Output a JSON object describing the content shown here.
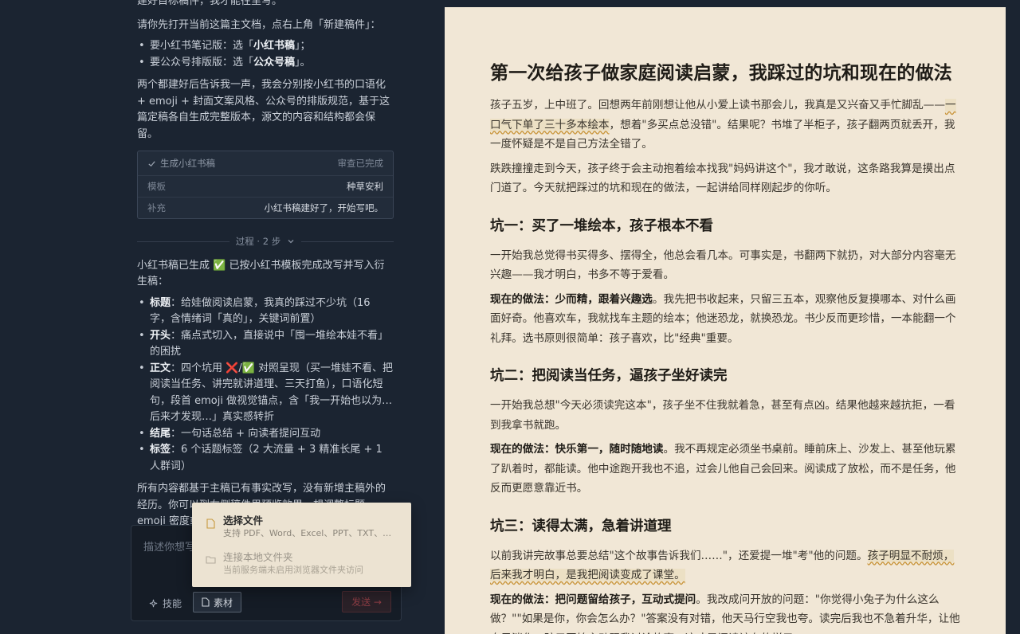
{
  "chat": {
    "intro_fragment": "建好目标稿件，我才能往里写。",
    "instruction": "请你先打开当前这篇主文档，点右上角「新建稿件」：",
    "steps": [
      {
        "prefix": "要小红书笔记版：选「",
        "bold": "小红书稿",
        "suffix": "」；"
      },
      {
        "prefix": "要公众号排版版：选「",
        "bold": "公众号稿",
        "suffix": "」。"
      }
    ],
    "followup": "两个都建好后告诉我一声，我会分别按小红书的口语化 + emoji + 封面文案风格、公众号的排版规范，基于这篇定稿各自生成完整版本，源文的内容和结构都会保留。",
    "task_card": {
      "title": "生成小红书稿",
      "status": "审查已完成",
      "rows": [
        {
          "key": "模板",
          "value": "种草安利"
        },
        {
          "key": "补充",
          "value": "小红书稿建好了，开始写吧。"
        }
      ]
    },
    "process_label": "过程 · 2 步",
    "result_intro": "小红书稿已生成 ✅ 已按小红书模板完成改写并写入衍生稿：",
    "result_items": [
      {
        "bold": "标题",
        "text": "：给娃做阅读启蒙，我真的踩过不少坑（16 字，含情绪词「真的」，关键词前置）"
      },
      {
        "bold": "开头",
        "text": "：痛点式切入，直接说中「囤一堆绘本娃不看」的困扰"
      },
      {
        "bold": "正文",
        "text": "：四个坑用 ❌/✅ 对照呈现（买一堆娃不看、把阅读当任务、讲完就讲道理、三天打鱼），口语化短句，段首 emoji 做视觉锚点，含「我一开始也以为…后来才发现…」真实感转折"
      },
      {
        "bold": "结尾",
        "text": "：一句话总结 + 向读者提问互动"
      },
      {
        "bold": "标签",
        "text": "：6 个话题标签（2 大流量 + 3 精准长尾 + 1 人群词）"
      }
    ],
    "closing": "所有内容都基于主稿已有事实改写，没有新增主稿外的经历。你可以到右侧稿件里预览效果，想调整标题、emoji 密度或标签组合，随时告诉我。"
  },
  "composer": {
    "placeholder": "描述你想写",
    "skill_label": "技能",
    "material_label": "素材",
    "send_label": "发送 →"
  },
  "upload_menu": {
    "options": [
      {
        "title": "选择文件",
        "desc": "支持 PDF、Word、Excel、PPT、TXT、Markdown",
        "icon": "file-icon",
        "enabled": true
      },
      {
        "title": "连接本地文件夹",
        "desc": "当前服务端未启用浏览器文件夹访问",
        "icon": "folder-icon",
        "enabled": false
      }
    ]
  },
  "document": {
    "title": "第一次给孩子做家庭阅读启蒙，我踩过的坑和现在的做法",
    "intro_1a": "孩子五岁，上中班了。回想两年前刚想让他从小爱上读书那会儿，我真是又兴奋又手忙脚乱——",
    "intro_1_highlight": "一口气下单了三十多本绘本",
    "intro_1b": "，想着\"多买点总没错\"。结果呢？书堆了半柜子，孩子翻两页就丢开，我一度怀疑是不是自己方法全错了。",
    "intro_2": "跌跌撞撞走到今天，孩子终于会主动抱着绘本找我\"妈妈讲这个\"，我才敢说，这条路我算是摸出点门道了。今天就把踩过的坑和现在的做法，一起讲给同样刚起步的你听。",
    "sections": [
      {
        "heading": "坑一：买了一堆绘本，孩子根本不看",
        "body": "一开始我总觉得书买得多、摆得全，他总会看几本。可事实是，书翻两下就扔，对大部分内容毫无兴趣——我才明白，书多不等于爱看。",
        "now_label": "现在的做法：少而精，跟着兴趣选",
        "now_text": "。我先把书收起来，只留三五本，观察他反复摸哪本、对什么画面好奇。他喜欢车，我就找车主题的绘本；他迷恐龙，就换恐龙。书少反而更珍惜，一本能翻一个礼拜。选书原则很简单：孩子喜欢，比\"经典\"重要。"
      },
      {
        "heading": "坑二：把阅读当任务，逼孩子坐好读完",
        "body": "一开始我总想\"今天必须读完这本\"，孩子坐不住我就着急，甚至有点凶。结果他越来越抗拒，一看到我拿书就跑。",
        "now_label": "现在的做法：快乐第一，随时随地读",
        "now_text": "。我不再规定必须坐书桌前。睡前床上、沙发上、甚至他玩累了趴着时，都能读。他中途跑开我也不追，过会儿他自己会回来。阅读成了放松，而不是任务，他反而更愿意靠近书。"
      },
      {
        "heading": "坑三：读得太满，急着讲道理",
        "body_a": "以前我讲完故事总要总结\"这个故事告诉我们……\"，还爱提一堆\"考\"他的问题。",
        "body_highlight": "孩子明显不耐烦，后来我才明白，是我把阅读变成了课堂。",
        "now_label": "现在的做法：把问题留给孩子，互动式提问",
        "now_text": "。我改成问开放的问题：\"你觉得小兔子为什么这么做？\"\"如果是你，你会怎么办？\"答案没有对错，他天马行空我也夸。读完后我也不急着升华，让他自己消化。孩子开始主动跟我讨论故事，这才是阅读该有的样子。"
      }
    ]
  }
}
